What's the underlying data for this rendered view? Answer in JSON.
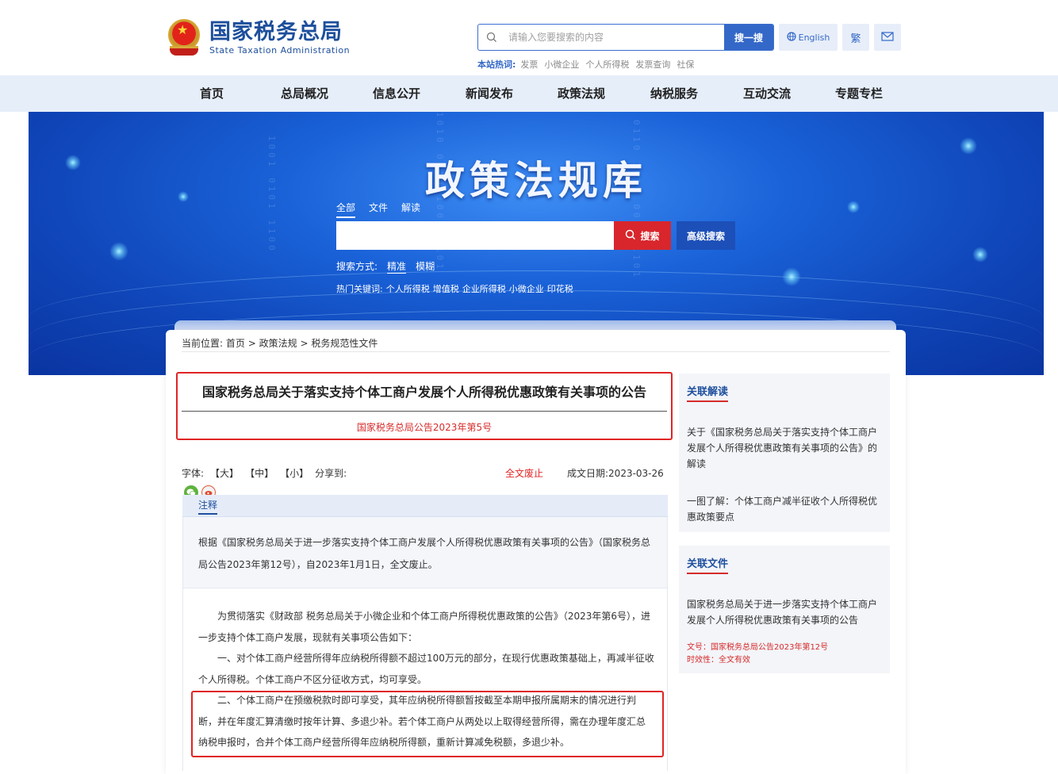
{
  "header": {
    "site_cn": "国家税务总局",
    "site_en": "State Taxation Administration",
    "search_placeholder": "请输入您要搜索的内容",
    "search_button": "搜一搜",
    "hot_label": "本站热词:",
    "hot_words": [
      "发票",
      "小微企业",
      "个人所得税",
      "发票查询",
      "社保"
    ],
    "english_label": "English",
    "traditional_label": "繁"
  },
  "nav": {
    "items": [
      "首页",
      "总局概况",
      "信息公开",
      "新闻发布",
      "政策法规",
      "纳税服务",
      "互动交流",
      "专题专栏"
    ]
  },
  "banner": {
    "title": "政策法规库",
    "tabs": [
      "全部",
      "文件",
      "解读"
    ],
    "search_button": "搜索",
    "advanced_button": "高级搜索",
    "mode_label": "搜索方式:",
    "modes": [
      "精准",
      "模糊"
    ],
    "hot_label": "热门关键词:",
    "hot_words": [
      "个人所得税",
      "增值税",
      "企业所得税",
      "小微企业",
      "印花税"
    ]
  },
  "breadcrumb": {
    "label": "当前位置:",
    "items": [
      "首页",
      "政策法规",
      "税务规范性文件"
    ],
    "separator": ">"
  },
  "document": {
    "title": "国家税务总局关于落实支持个体工商户发展个人所得税优惠政策有关事项的公告",
    "number": "国家税务总局公告2023年第5号",
    "font_label": "字体:",
    "font_sizes": [
      "【大】",
      "【中】",
      "【小】"
    ],
    "share_label": "分享到:",
    "status": "全文废止",
    "date_label": "成文日期:",
    "date": "2023-03-26",
    "note_heading": "注释",
    "note_text": "根据《国家税务总局关于进一步落实支持个体工商户发展个人所得税优惠政策有关事项的公告》（国家税务总局公告2023年第12号），自2023年1月1日，全文废止。",
    "paragraphs": [
      "为贯彻落实《财政部 税务总局关于小微企业和个体工商户所得税优惠政策的公告》（2023年第6号），进一步支持个体工商户发展，现就有关事项公告如下：",
      "一、对个体工商户经营所得年应纳税所得额不超过100万元的部分，在现行优惠政策基础上，再减半征收个人所得税。个体工商户不区分征收方式，均可享受。",
      "二、个体工商户在预缴税款时即可享受，其年应纳税所得额暂按截至本期申报所属期末的情况进行判断，并在年度汇算清缴时按年计算、多退少补。若个体工商户从两处以上取得经营所得，需在办理年度汇总纳税申报时，合并个体工商户经营所得年应纳税所得额，重新计算减免税额，多退少补。"
    ]
  },
  "sidebar": {
    "interpret_heading": "关联解读",
    "interpret_items": [
      "关于《国家税务总局关于落实支持个体工商户发展个人所得税优惠政策有关事项的公告》的解读",
      "一图了解：个体工商户减半征收个人所得税优惠政策要点"
    ],
    "files_heading": "关联文件",
    "file_title": "国家税务总局关于进一步落实支持个体工商户发展个人所得税优惠政策有关事项的公告",
    "file_no": "文号：国家税务总局公告2023年第12号",
    "file_status": "时效性：全文有效"
  },
  "colors": {
    "brand_blue": "#1d4f9c",
    "accent_red": "#e02424",
    "nav_bg": "#e6eefa"
  }
}
